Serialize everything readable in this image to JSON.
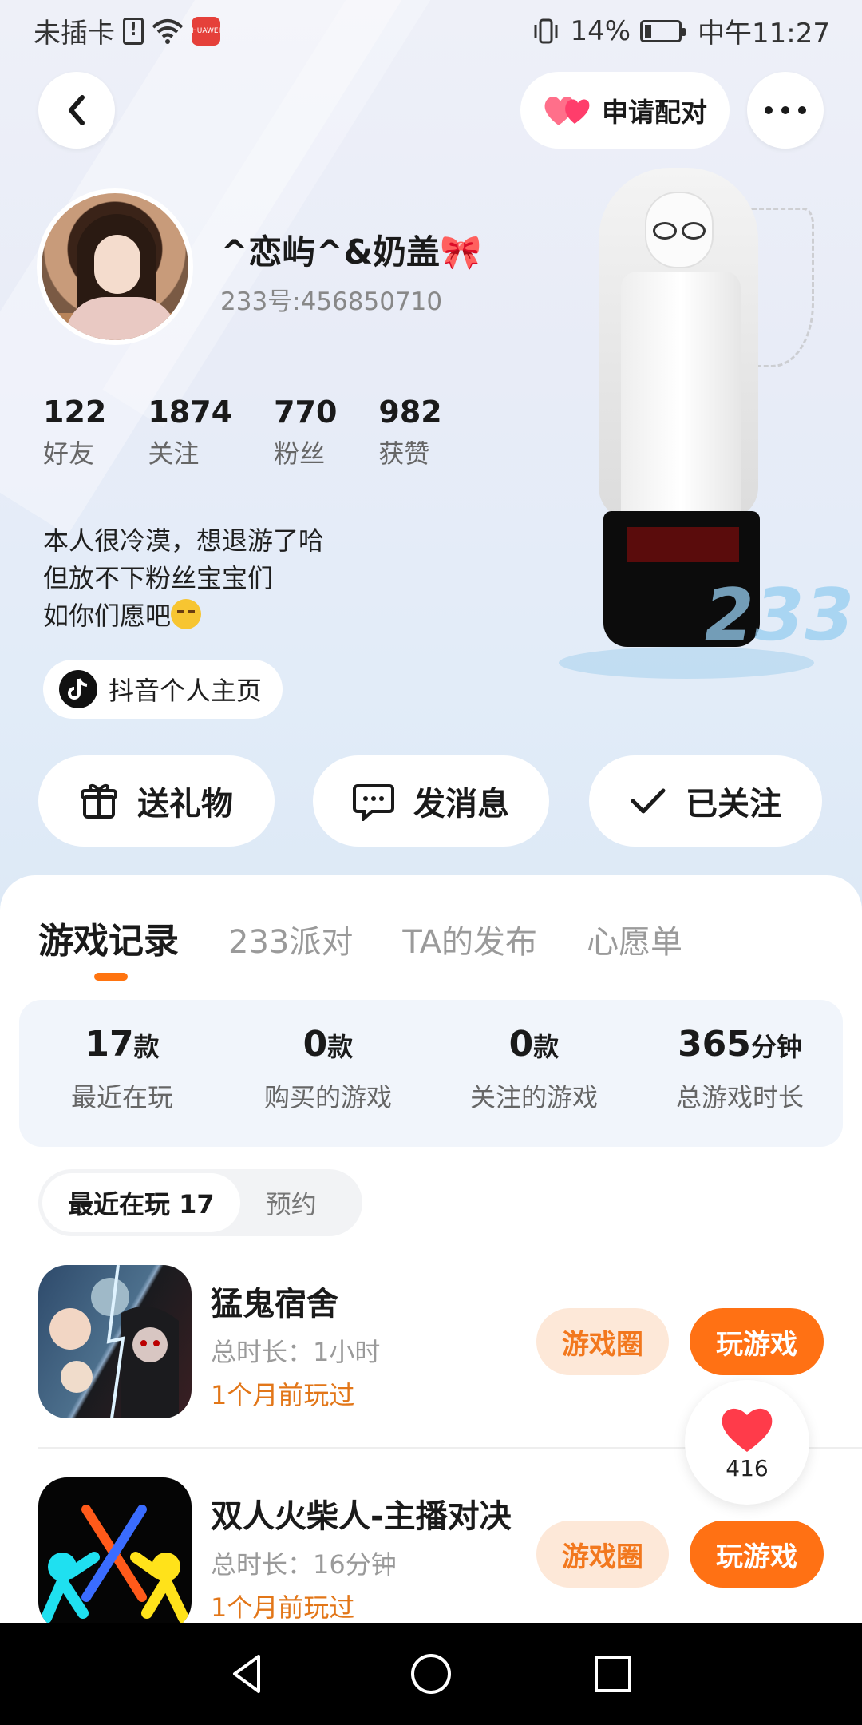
{
  "status_bar": {
    "carrier": "未插卡",
    "sim_icon": "sim-card-icon",
    "wifi_icon": "wifi-icon",
    "app_icon_label": "HUAWEI",
    "battery_percent": "14%",
    "time": "中午11:27"
  },
  "top_bar": {
    "pair_label": "申请配对"
  },
  "profile": {
    "nickname": "^恋屿^&奶盖🎀",
    "uid": "233号:456850710",
    "stats": [
      {
        "value": "122",
        "label": "好友"
      },
      {
        "value": "1874",
        "label": "关注"
      },
      {
        "value": "770",
        "label": "粉丝"
      },
      {
        "value": "982",
        "label": "获赞"
      }
    ],
    "bio_lines": [
      "本人很冷漠，想退游了哈",
      "但放不下粉丝宝宝们",
      "如你们愿吧"
    ],
    "douyin_label": "抖音个人主页",
    "figure_logo": "233"
  },
  "actions": {
    "gift": "送礼物",
    "message": "发消息",
    "follow": "已关注"
  },
  "tabs": [
    {
      "label": "游戏记录",
      "active": true
    },
    {
      "label": "233派对",
      "active": false
    },
    {
      "label": "TA的发布",
      "active": false
    },
    {
      "label": "心愿单",
      "active": false
    }
  ],
  "summary": [
    {
      "value": "17",
      "unit": "款",
      "label": "最近在玩"
    },
    {
      "value": "0",
      "unit": "款",
      "label": "购买的游戏"
    },
    {
      "value": "0",
      "unit": "款",
      "label": "关注的游戏"
    },
    {
      "value": "365",
      "unit": "分钟",
      "label": "总游戏时长"
    }
  ],
  "segment": {
    "active": "最近在玩 17",
    "inactive": "预约"
  },
  "games": [
    {
      "name": "猛鬼宿舍",
      "total_time": "总时长：1小时",
      "last_played": "1个月前玩过",
      "circle_label": "游戏圈",
      "play_label": "玩游戏"
    },
    {
      "name": "双人火柴人-主播对决",
      "total_time": "总时长：16分钟",
      "last_played": "1个月前玩过",
      "circle_label": "游戏圈",
      "play_label": "玩游戏"
    }
  ],
  "like_float": {
    "count": "416"
  },
  "colors": {
    "accent": "#ff7114",
    "accent_light": "#fde8d8",
    "recent_text": "#e27618"
  }
}
